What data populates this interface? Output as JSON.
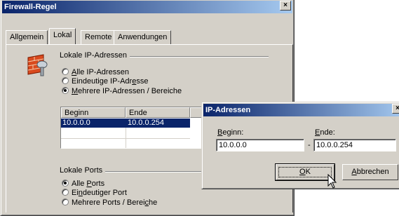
{
  "main_dialog": {
    "title": "Firewall-Regel",
    "close_glyph": "×"
  },
  "tabs": [
    {
      "label": "Allgemein"
    },
    {
      "label": "Lokal"
    },
    {
      "label": "Remote"
    },
    {
      "label": "Anwendungen"
    }
  ],
  "ip_group": {
    "title": "Lokale IP-Adressen",
    "icon": "firewall-brick-icon",
    "options": [
      {
        "pre": "",
        "u": "A",
        "post": "lle IP-Adressen",
        "checked": false
      },
      {
        "pre": "Eindeutige IP-Adr",
        "u": "e",
        "post": "sse",
        "checked": false
      },
      {
        "pre": "",
        "u": "M",
        "post": "ehrere IP-Adressen / Bereiche",
        "checked": true
      }
    ],
    "list": {
      "columns": [
        "Beginn",
        "Ende"
      ],
      "rows": [
        {
          "start": "10.0.0.0",
          "end": "10.0.0.254",
          "selected": true
        }
      ]
    }
  },
  "ports_group": {
    "title": "Lokale Ports",
    "options": [
      {
        "pre": "Alle ",
        "u": "P",
        "post": "orts",
        "checked": true
      },
      {
        "pre": "Ei",
        "u": "n",
        "post": "deutiger Port",
        "checked": false
      },
      {
        "pre": "Mehrere Ports / Berei",
        "u": "c",
        "post": "he",
        "checked": false
      }
    ]
  },
  "ip_dialog": {
    "title": "IP-Adressen",
    "close_glyph": "×",
    "start_label": {
      "u": "B",
      "post": "eginn:"
    },
    "end_label": {
      "u": "E",
      "post": "nde:"
    },
    "start_value": "10.0.0.0",
    "separator": "-",
    "end_value": "10.0.0.254",
    "ok_button": {
      "u": "O",
      "post": "K"
    },
    "cancel_button": {
      "u": "A",
      "post": "bbrechen"
    }
  }
}
